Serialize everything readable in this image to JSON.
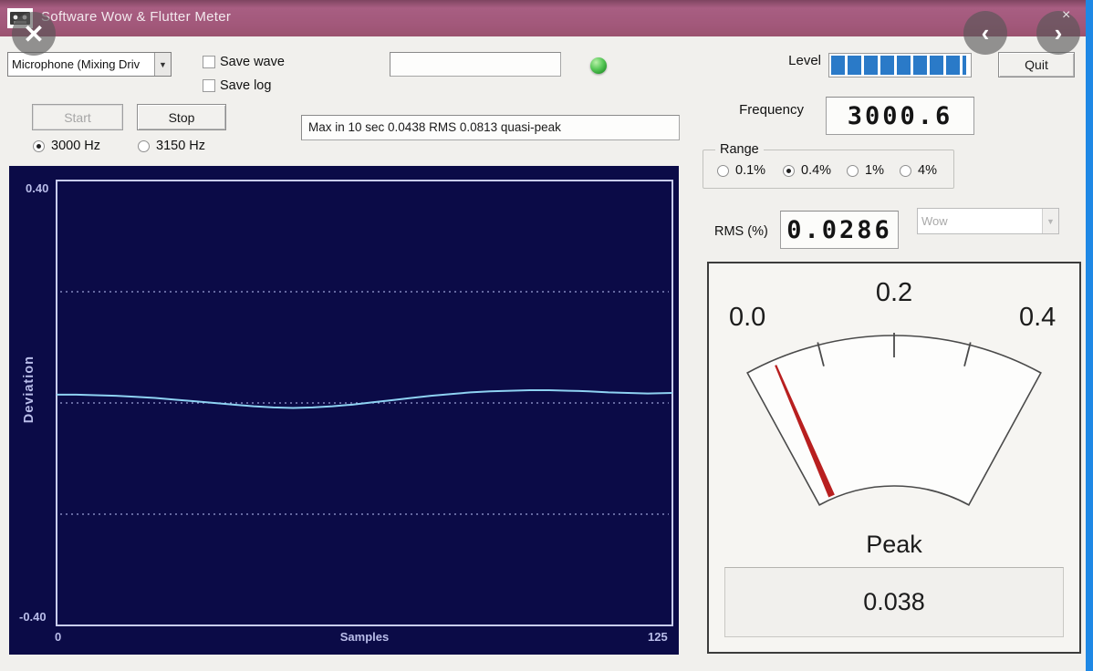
{
  "titlebar": {
    "title": "Software Wow & Flutter Meter",
    "color": "#a2587a"
  },
  "viewer_overlay": {
    "close_glyph": "✕",
    "prev_glyph": "‹",
    "next_glyph": "›",
    "corner_close_glyph": "×"
  },
  "controls": {
    "input_device": {
      "value": "Microphone (Mixing Driv",
      "arrow_glyph": "▼"
    },
    "checkboxes": [
      {
        "label": "Save wave",
        "checked": false
      },
      {
        "label": "Save log",
        "checked": false
      }
    ],
    "filename_field": {
      "value": ""
    },
    "start_button": {
      "label": "Start",
      "enabled": false
    },
    "stop_button": {
      "label": "Stop",
      "enabled": true
    },
    "freq_select_radios": [
      {
        "label": "3000 Hz",
        "selected": true
      },
      {
        "label": "3150 Hz",
        "selected": false
      }
    ],
    "status_field": {
      "value": "Max in 10 sec 0.0438 RMS 0.0813 quasi-peak"
    },
    "led_color": "#3fae43",
    "level_meter": {
      "label": "Level",
      "segments_on": 8,
      "partial_segment": true,
      "color": "#2a7ac8"
    },
    "quit_button": {
      "label": "Quit"
    }
  },
  "readouts": {
    "frequency": {
      "label": "Frequency",
      "value": "3000.6"
    },
    "range": {
      "label": "Range",
      "options": [
        {
          "label": "0.1%",
          "selected": false
        },
        {
          "label": "0.4%",
          "selected": true
        },
        {
          "label": "1%",
          "selected": false
        },
        {
          "label": "4%",
          "selected": false
        }
      ]
    },
    "rms": {
      "label": "RMS (%)",
      "value": "0.0286"
    },
    "mode_select": {
      "value": "Wow",
      "enabled": false,
      "arrow_glyph": "▼"
    }
  },
  "gauge": {
    "min": 0.0,
    "max": 0.4,
    "scale_labels": [
      "0.0",
      "0.2",
      "0.4"
    ],
    "ticks": [
      0.1,
      0.2,
      0.3
    ],
    "needle_value": 0.038,
    "needle_color": "#b81f1f",
    "peak_label": "Peak",
    "peak_value": "0.038"
  },
  "chart_data": {
    "type": "line",
    "title": "",
    "xlabel": "Samples",
    "ylabel": "Deviation",
    "xlim": [
      0,
      125
    ],
    "ylim": [
      -0.4,
      0.4
    ],
    "x_tick_labels": [
      "0",
      "125"
    ],
    "y_tick_labels": [
      "0.40",
      "-0.40"
    ],
    "gridlines_y": [
      0.2,
      0.0,
      -0.2
    ],
    "grid_style": "dotted",
    "legend": false,
    "bg_color": "#0b0b47",
    "line_color": "#8ed2f2",
    "grid_color": "#9aa0d6",
    "series": [
      {
        "name": "deviation",
        "x": [
          0,
          4,
          8,
          12,
          16,
          20,
          24,
          28,
          32,
          36,
          40,
          44,
          48,
          52,
          56,
          60,
          64,
          68,
          72,
          76,
          80,
          84,
          88,
          92,
          96,
          100,
          104,
          108,
          112,
          116,
          120,
          125
        ],
        "y": [
          0.015,
          0.015,
          0.014,
          0.013,
          0.011,
          0.009,
          0.006,
          0.003,
          0.0,
          -0.003,
          -0.006,
          -0.008,
          -0.009,
          -0.008,
          -0.006,
          -0.003,
          0.001,
          0.005,
          0.009,
          0.013,
          0.016,
          0.019,
          0.021,
          0.022,
          0.023,
          0.023,
          0.022,
          0.021,
          0.019,
          0.018,
          0.017,
          0.018
        ]
      }
    ]
  }
}
